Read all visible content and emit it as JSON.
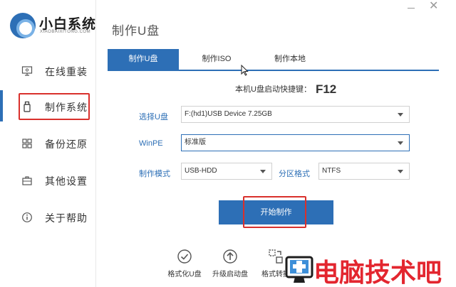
{
  "app": {
    "name": "小白系统",
    "subtitle": "XIAOBAIXITONG.COM"
  },
  "sidebar": {
    "items": [
      {
        "label": "在线重装",
        "icon": "monitor-icon"
      },
      {
        "label": "制作系统",
        "icon": "usb-drive-icon",
        "active": true
      },
      {
        "label": "备份还原",
        "icon": "backup-grid-icon"
      },
      {
        "label": "其他设置",
        "icon": "toolbox-icon"
      },
      {
        "label": "关于帮助",
        "icon": "info-icon"
      }
    ]
  },
  "header": {
    "title": "制作U盘"
  },
  "tabs": [
    {
      "label": "制作U盘",
      "active": true
    },
    {
      "label": "制作ISO"
    },
    {
      "label": "制作本地"
    }
  ],
  "hotkey": {
    "label": "本机U盘启动快捷键：",
    "key": "F12"
  },
  "form": {
    "usb": {
      "label": "选择U盘",
      "value": "F:(hd1)USB Device 7.25GB"
    },
    "winpe": {
      "label": "WinPE",
      "value": "标准版"
    },
    "mode": {
      "label": "制作模式",
      "value": "USB-HDD"
    },
    "partition": {
      "label": "分区格式",
      "value": "NTFS"
    }
  },
  "start_button": {
    "label": "开始制作"
  },
  "tools": [
    {
      "label": "格式化U盘",
      "icon": "check-circle-icon"
    },
    {
      "label": "升级启动盘",
      "icon": "upload-circle-icon"
    },
    {
      "label": "格式转换",
      "icon": "convert-icon"
    }
  ],
  "watermark": {
    "text": "电脑技术吧"
  },
  "colors": {
    "accent": "#2d6fb6",
    "highlight_box": "#d9302c",
    "watermark": "#e3262f"
  }
}
